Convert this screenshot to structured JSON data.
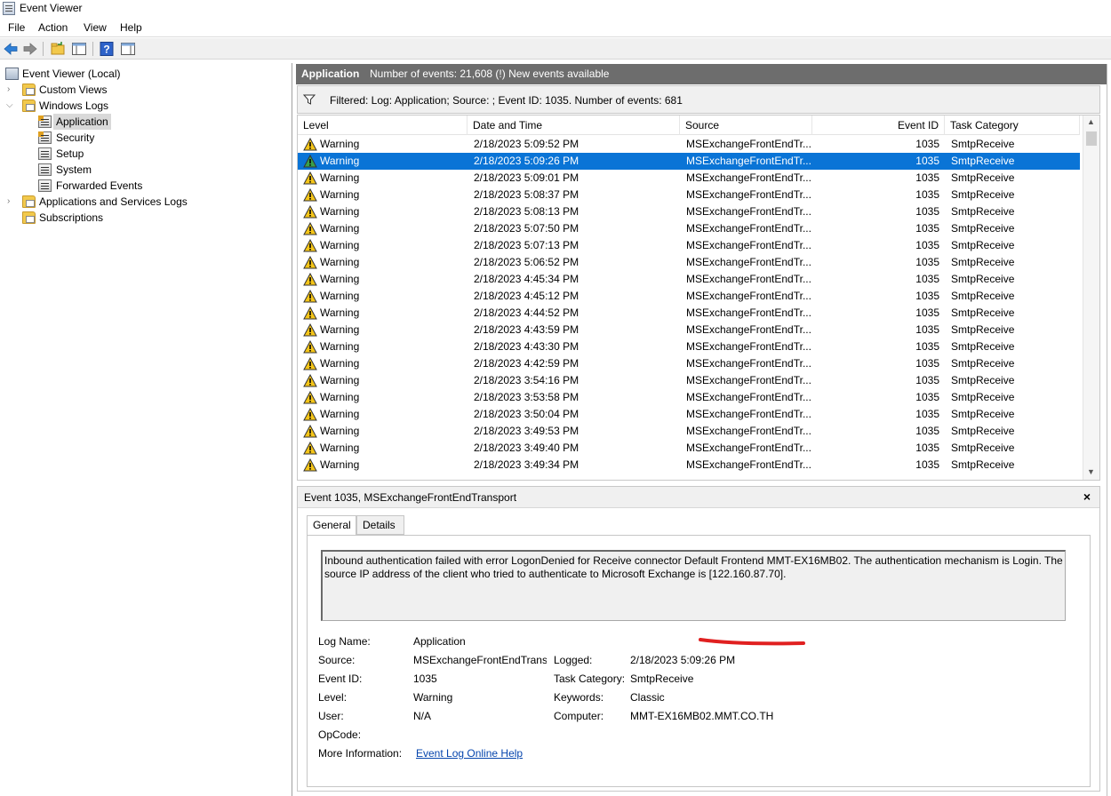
{
  "window": {
    "title": "Event Viewer"
  },
  "menu": [
    "File",
    "Action",
    "View",
    "Help"
  ],
  "toolbar_icons": [
    "back-arrow-icon",
    "forward-arrow-icon",
    "open-folder-icon",
    "show-hide-tree-icon",
    "help-icon",
    "show-hide-action-pane-icon"
  ],
  "tree": {
    "root": "Event Viewer (Local)",
    "custom_views": "Custom Views",
    "windows_logs": "Windows Logs",
    "logs": [
      "Application",
      "Security",
      "Setup",
      "System",
      "Forwarded Events"
    ],
    "apps_services": "Applications and Services Logs",
    "subscriptions": "Subscriptions",
    "selected": "Application"
  },
  "header": {
    "title": "Application",
    "count_text": "Number of events: 21,608 (!) New events available"
  },
  "filter": {
    "text": "Filtered: Log: Application; Source: ; Event ID: 1035. Number of events: 681"
  },
  "columns": [
    "Level",
    "Date and Time",
    "Source",
    "Event ID",
    "Task Category"
  ],
  "rows": [
    {
      "level": "Warning",
      "datetime": "2/18/2023 5:09:52 PM",
      "source": "MSExchangeFrontEndTr...",
      "event_id": "1035",
      "category": "SmtpReceive"
    },
    {
      "level": "Warning",
      "datetime": "2/18/2023 5:09:26 PM",
      "source": "MSExchangeFrontEndTr...",
      "event_id": "1035",
      "category": "SmtpReceive",
      "selected": true
    },
    {
      "level": "Warning",
      "datetime": "2/18/2023 5:09:01 PM",
      "source": "MSExchangeFrontEndTr...",
      "event_id": "1035",
      "category": "SmtpReceive"
    },
    {
      "level": "Warning",
      "datetime": "2/18/2023 5:08:37 PM",
      "source": "MSExchangeFrontEndTr...",
      "event_id": "1035",
      "category": "SmtpReceive"
    },
    {
      "level": "Warning",
      "datetime": "2/18/2023 5:08:13 PM",
      "source": "MSExchangeFrontEndTr...",
      "event_id": "1035",
      "category": "SmtpReceive"
    },
    {
      "level": "Warning",
      "datetime": "2/18/2023 5:07:50 PM",
      "source": "MSExchangeFrontEndTr...",
      "event_id": "1035",
      "category": "SmtpReceive"
    },
    {
      "level": "Warning",
      "datetime": "2/18/2023 5:07:13 PM",
      "source": "MSExchangeFrontEndTr...",
      "event_id": "1035",
      "category": "SmtpReceive"
    },
    {
      "level": "Warning",
      "datetime": "2/18/2023 5:06:52 PM",
      "source": "MSExchangeFrontEndTr...",
      "event_id": "1035",
      "category": "SmtpReceive"
    },
    {
      "level": "Warning",
      "datetime": "2/18/2023 4:45:34 PM",
      "source": "MSExchangeFrontEndTr...",
      "event_id": "1035",
      "category": "SmtpReceive"
    },
    {
      "level": "Warning",
      "datetime": "2/18/2023 4:45:12 PM",
      "source": "MSExchangeFrontEndTr...",
      "event_id": "1035",
      "category": "SmtpReceive"
    },
    {
      "level": "Warning",
      "datetime": "2/18/2023 4:44:52 PM",
      "source": "MSExchangeFrontEndTr...",
      "event_id": "1035",
      "category": "SmtpReceive"
    },
    {
      "level": "Warning",
      "datetime": "2/18/2023 4:43:59 PM",
      "source": "MSExchangeFrontEndTr...",
      "event_id": "1035",
      "category": "SmtpReceive"
    },
    {
      "level": "Warning",
      "datetime": "2/18/2023 4:43:30 PM",
      "source": "MSExchangeFrontEndTr...",
      "event_id": "1035",
      "category": "SmtpReceive"
    },
    {
      "level": "Warning",
      "datetime": "2/18/2023 4:42:59 PM",
      "source": "MSExchangeFrontEndTr...",
      "event_id": "1035",
      "category": "SmtpReceive"
    },
    {
      "level": "Warning",
      "datetime": "2/18/2023 3:54:16 PM",
      "source": "MSExchangeFrontEndTr...",
      "event_id": "1035",
      "category": "SmtpReceive"
    },
    {
      "level": "Warning",
      "datetime": "2/18/2023 3:53:58 PM",
      "source": "MSExchangeFrontEndTr...",
      "event_id": "1035",
      "category": "SmtpReceive"
    },
    {
      "level": "Warning",
      "datetime": "2/18/2023 3:50:04 PM",
      "source": "MSExchangeFrontEndTr...",
      "event_id": "1035",
      "category": "SmtpReceive"
    },
    {
      "level": "Warning",
      "datetime": "2/18/2023 3:49:53 PM",
      "source": "MSExchangeFrontEndTr...",
      "event_id": "1035",
      "category": "SmtpReceive"
    },
    {
      "level": "Warning",
      "datetime": "2/18/2023 3:49:40 PM",
      "source": "MSExchangeFrontEndTr...",
      "event_id": "1035",
      "category": "SmtpReceive"
    },
    {
      "level": "Warning",
      "datetime": "2/18/2023 3:49:34 PM",
      "source": "MSExchangeFrontEndTr...",
      "event_id": "1035",
      "category": "SmtpReceive"
    }
  ],
  "detail": {
    "title": "Event 1035, MSExchangeFrontEndTransport",
    "close": "×",
    "tabs": [
      "General",
      "Details"
    ],
    "active_tab": "General",
    "message": "Inbound authentication failed with error LogonDenied for Receive connector Default Frontend MMT-EX16MB02. The authentication mechanism is Login. The source IP address of the client who tried to authenticate to Microsoft Exchange is [122.160.87.70].",
    "fields": {
      "log_name_label": "Log Name:",
      "log_name": "Application",
      "source_label": "Source:",
      "source": "MSExchangeFrontEndTransp",
      "logged_label": "Logged:",
      "logged": "2/18/2023 5:09:26 PM",
      "event_id_label": "Event ID:",
      "event_id": "1035",
      "task_category_label": "Task Category:",
      "task_category": "SmtpReceive",
      "level_label": "Level:",
      "level": "Warning",
      "keywords_label": "Keywords:",
      "keywords": "Classic",
      "user_label": "User:",
      "user": "N/A",
      "computer_label": "Computer:",
      "computer": "MMT-EX16MB02.MMT.CO.TH",
      "opcode_label": "OpCode:",
      "opcode": "",
      "more_info_label": "More Information:",
      "more_info_link": "Event Log Online Help"
    }
  },
  "colors": {
    "header_bg": "#6d6d6d",
    "selection": "#0a74d6",
    "annotation_red": "#e02020",
    "link": "#0645ad"
  }
}
